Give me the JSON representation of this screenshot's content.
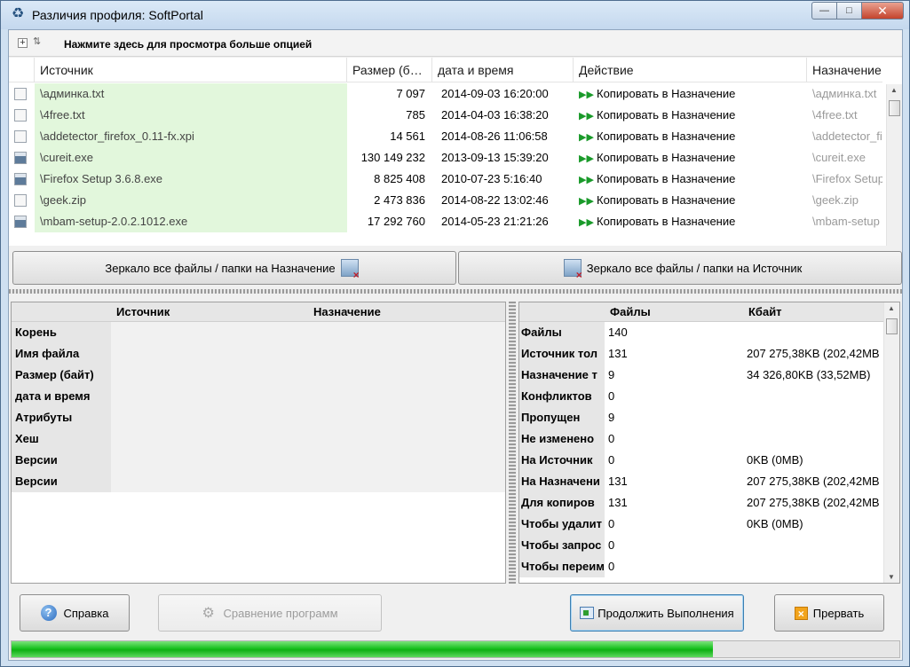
{
  "window": {
    "title": "Различия профиля: SoftPortal",
    "app_icon": "sync-icon"
  },
  "options_bar": {
    "text": "Нажмите здесь для просмотра больше опцией"
  },
  "grid": {
    "columns": [
      "Источник",
      "Размер (б…",
      "дата и время",
      "Действие",
      "Назначение"
    ],
    "rows": [
      {
        "icon": "text-file-icon",
        "source": "\\админка.txt",
        "size": "7 097",
        "date": "2014-09-03 16:20:00",
        "action": "Копировать в Назначение",
        "dest": "\\админка.txt"
      },
      {
        "icon": "text-file-icon",
        "source": "\\4free.txt",
        "size": "785",
        "date": "2014-04-03 16:38:20",
        "action": "Копировать в Назначение",
        "dest": "\\4free.txt"
      },
      {
        "icon": "text-file-icon",
        "source": "\\addetector_firefox_0.11-fx.xpi",
        "size": "14 561",
        "date": "2014-08-26 11:06:58",
        "action": "Копировать в Назначение",
        "dest": "\\addetector_fir"
      },
      {
        "icon": "exe-file-icon",
        "source": "\\cureit.exe",
        "size": "130 149 232",
        "date": "2013-09-13 15:39:20",
        "action": "Копировать в Назначение",
        "dest": "\\cureit.exe"
      },
      {
        "icon": "exe-file-icon",
        "source": "\\Firefox Setup 3.6.8.exe",
        "size": "8 825 408",
        "date": "2010-07-23 5:16:40",
        "action": "Копировать в Назначение",
        "dest": "\\Firefox Setup"
      },
      {
        "icon": "blank-file-icon",
        "source": "\\geek.zip",
        "size": "2 473 836",
        "date": "2014-08-22 13:02:46",
        "action": "Копировать в Назначение",
        "dest": "\\geek.zip"
      },
      {
        "icon": "exe-file-icon",
        "source": "\\mbam-setup-2.0.2.1012.exe",
        "size": "17 292 760",
        "date": "2014-05-23 21:21:26",
        "action": "Копировать в Назначение",
        "dest": "\\mbam-setup"
      }
    ]
  },
  "mirror_buttons": {
    "to_dest": "Зеркало все файлы / папки на Назначение",
    "to_source": "Зеркало все файлы / папки на Источник"
  },
  "properties": {
    "headers": [
      "Источник",
      "Назначение"
    ],
    "rows": [
      "Корень",
      "Имя файла",
      "Размер (байт)",
      "дата и время",
      "Атрибуты",
      "Хеш",
      "Версии",
      "Версии"
    ]
  },
  "stats": {
    "headers": [
      "Файлы",
      "Кбайт"
    ],
    "rows": [
      {
        "label": "Файлы",
        "files": "140",
        "kb": ""
      },
      {
        "label": "Источник тол",
        "files": "131",
        "kb": "207 275,38KB (202,42MB"
      },
      {
        "label": "Назначение т",
        "files": "9",
        "kb": "34 326,80KB (33,52MB)"
      },
      {
        "label": "Конфликтов",
        "files": "0",
        "kb": ""
      },
      {
        "label": "Пропущен",
        "files": "9",
        "kb": ""
      },
      {
        "label": "Не изменено",
        "files": "0",
        "kb": ""
      },
      {
        "label": "На Источник",
        "files": "0",
        "kb": "0KB (0MB)"
      },
      {
        "label": "На Назначени",
        "files": "131",
        "kb": "207 275,38KB (202,42MB"
      },
      {
        "label": "Для копиров",
        "files": "131",
        "kb": "207 275,38KB (202,42MB"
      },
      {
        "label": "Чтобы удалит",
        "files": "0",
        "kb": "0KB (0MB)"
      },
      {
        "label": "Чтобы запрос",
        "files": "0",
        "kb": ""
      },
      {
        "label": "Чтобы переим",
        "files": "0",
        "kb": ""
      }
    ]
  },
  "footer": {
    "help": "Справка",
    "compare": "Сравнение программ",
    "continue": "Продолжить Выполнения",
    "cancel": "Прервать"
  },
  "progress_fraction": 0.79,
  "colors": {
    "source_column_bg": "#e2f7dc",
    "progress_green": "#19c21f",
    "action_arrow": "#1a9a2a"
  }
}
